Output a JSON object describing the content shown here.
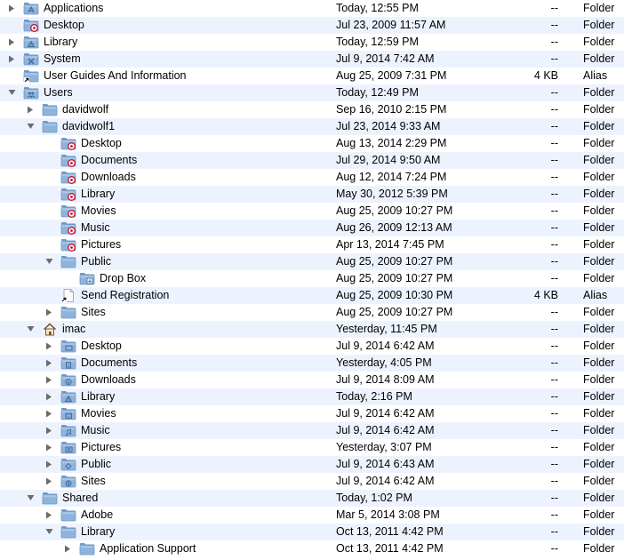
{
  "rows": [
    {
      "name": "Applications",
      "date": "Today, 12:55 PM",
      "size": "--",
      "kind": "Folder",
      "level": 0,
      "tri": "closed",
      "icon": "folder-app"
    },
    {
      "name": "Desktop",
      "date": "Jul 23, 2009 11:57 AM",
      "size": "--",
      "kind": "Folder",
      "level": 0,
      "tri": "none",
      "icon": "folder-restricted"
    },
    {
      "name": "Library",
      "date": "Today, 12:59 PM",
      "size": "--",
      "kind": "Folder",
      "level": 0,
      "tri": "closed",
      "icon": "folder-library"
    },
    {
      "name": "System",
      "date": "Jul 9, 2014 7:42 AM",
      "size": "--",
      "kind": "Folder",
      "level": 0,
      "tri": "closed",
      "icon": "folder-system"
    },
    {
      "name": "User Guides And Information",
      "date": "Aug 25, 2009 7:31 PM",
      "size": "4 KB",
      "kind": "Alias",
      "level": 0,
      "tri": "none",
      "icon": "alias-folder"
    },
    {
      "name": "Users",
      "date": "Today, 12:49 PM",
      "size": "--",
      "kind": "Folder",
      "level": 0,
      "tri": "open",
      "icon": "folder-users"
    },
    {
      "name": "davidwolf",
      "date": "Sep 16, 2010 2:15 PM",
      "size": "--",
      "kind": "Folder",
      "level": 1,
      "tri": "closed",
      "icon": "folder"
    },
    {
      "name": "davidwolf1",
      "date": "Jul 23, 2014 9:33 AM",
      "size": "--",
      "kind": "Folder",
      "level": 1,
      "tri": "open",
      "icon": "folder"
    },
    {
      "name": "Desktop",
      "date": "Aug 13, 2014 2:29 PM",
      "size": "--",
      "kind": "Folder",
      "level": 2,
      "tri": "none",
      "icon": "folder-restricted"
    },
    {
      "name": "Documents",
      "date": "Jul 29, 2014 9:50 AM",
      "size": "--",
      "kind": "Folder",
      "level": 2,
      "tri": "none",
      "icon": "folder-restricted"
    },
    {
      "name": "Downloads",
      "date": "Aug 12, 2014 7:24 PM",
      "size": "--",
      "kind": "Folder",
      "level": 2,
      "tri": "none",
      "icon": "folder-restricted"
    },
    {
      "name": "Library",
      "date": "May 30, 2012 5:39 PM",
      "size": "--",
      "kind": "Folder",
      "level": 2,
      "tri": "none",
      "icon": "folder-restricted"
    },
    {
      "name": "Movies",
      "date": "Aug 25, 2009 10:27 PM",
      "size": "--",
      "kind": "Folder",
      "level": 2,
      "tri": "none",
      "icon": "folder-restricted"
    },
    {
      "name": "Music",
      "date": "Aug 26, 2009 12:13 AM",
      "size": "--",
      "kind": "Folder",
      "level": 2,
      "tri": "none",
      "icon": "folder-restricted"
    },
    {
      "name": "Pictures",
      "date": "Apr 13, 2014 7:45 PM",
      "size": "--",
      "kind": "Folder",
      "level": 2,
      "tri": "none",
      "icon": "folder-restricted"
    },
    {
      "name": "Public",
      "date": "Aug 25, 2009 10:27 PM",
      "size": "--",
      "kind": "Folder",
      "level": 2,
      "tri": "open",
      "icon": "folder"
    },
    {
      "name": "Drop Box",
      "date": "Aug 25, 2009 10:27 PM",
      "size": "--",
      "kind": "Folder",
      "level": 3,
      "tri": "none",
      "icon": "folder-dropbox"
    },
    {
      "name": "Send Registration",
      "date": "Aug 25, 2009 10:30 PM",
      "size": "4 KB",
      "kind": "Alias",
      "level": 2,
      "tri": "none",
      "icon": "alias-doc"
    },
    {
      "name": "Sites",
      "date": "Aug 25, 2009 10:27 PM",
      "size": "--",
      "kind": "Folder",
      "level": 2,
      "tri": "closed",
      "icon": "folder"
    },
    {
      "name": "imac",
      "date": "Yesterday, 11:45 PM",
      "size": "--",
      "kind": "Folder",
      "level": 1,
      "tri": "open",
      "icon": "home"
    },
    {
      "name": "Desktop",
      "date": "Jul 9, 2014 6:42 AM",
      "size": "--",
      "kind": "Folder",
      "level": 2,
      "tri": "closed",
      "icon": "folder-desktop"
    },
    {
      "name": "Documents",
      "date": "Yesterday, 4:05 PM",
      "size": "--",
      "kind": "Folder",
      "level": 2,
      "tri": "closed",
      "icon": "folder-documents"
    },
    {
      "name": "Downloads",
      "date": "Jul 9, 2014 8:09 AM",
      "size": "--",
      "kind": "Folder",
      "level": 2,
      "tri": "closed",
      "icon": "folder-downloads"
    },
    {
      "name": "Library",
      "date": "Today, 2:16 PM",
      "size": "--",
      "kind": "Folder",
      "level": 2,
      "tri": "closed",
      "icon": "folder-library"
    },
    {
      "name": "Movies",
      "date": "Jul 9, 2014 6:42 AM",
      "size": "--",
      "kind": "Folder",
      "level": 2,
      "tri": "closed",
      "icon": "folder-movies"
    },
    {
      "name": "Music",
      "date": "Jul 9, 2014 6:42 AM",
      "size": "--",
      "kind": "Folder",
      "level": 2,
      "tri": "closed",
      "icon": "folder-music"
    },
    {
      "name": "Pictures",
      "date": "Yesterday, 3:07 PM",
      "size": "--",
      "kind": "Folder",
      "level": 2,
      "tri": "closed",
      "icon": "folder-pictures"
    },
    {
      "name": "Public",
      "date": "Jul 9, 2014 6:43 AM",
      "size": "--",
      "kind": "Folder",
      "level": 2,
      "tri": "closed",
      "icon": "folder-public"
    },
    {
      "name": "Sites",
      "date": "Jul 9, 2014 6:42 AM",
      "size": "--",
      "kind": "Folder",
      "level": 2,
      "tri": "closed",
      "icon": "folder-sites"
    },
    {
      "name": "Shared",
      "date": "Today, 1:02 PM",
      "size": "--",
      "kind": "Folder",
      "level": 1,
      "tri": "open",
      "icon": "folder"
    },
    {
      "name": "Adobe",
      "date": "Mar 5, 2014 3:08 PM",
      "size": "--",
      "kind": "Folder",
      "level": 2,
      "tri": "closed",
      "icon": "folder"
    },
    {
      "name": "Library",
      "date": "Oct 13, 2011 4:42 PM",
      "size": "--",
      "kind": "Folder",
      "level": 2,
      "tri": "open",
      "icon": "folder"
    },
    {
      "name": "Application Support",
      "date": "Oct 13, 2011 4:42 PM",
      "size": "--",
      "kind": "Folder",
      "level": 3,
      "tri": "closed",
      "icon": "folder"
    }
  ]
}
